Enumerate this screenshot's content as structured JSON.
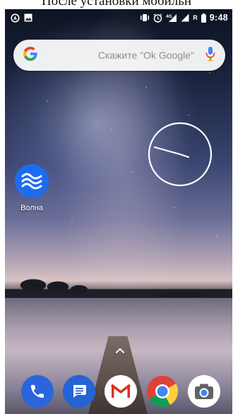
{
  "caption": {
    "text": "После установки мобильн"
  },
  "status_bar": {
    "left_icons": [
      "location-icon",
      "image-notification-icon"
    ],
    "right_icons": [
      "vibrate-icon",
      "alarm-icon",
      "signal-4g-icon",
      "signal-icon",
      "battery-icon"
    ],
    "network": "4G",
    "roaming": "R",
    "time": "9:48"
  },
  "search": {
    "hint": "Скажите \"Ok Google\""
  },
  "clock": {
    "hour_hand": "~9",
    "minute_hand": "~48"
  },
  "apps": [
    {
      "label": "Волна",
      "icon": "wave-icon"
    }
  ],
  "dock": [
    {
      "name": "phone",
      "icon": "phone-icon"
    },
    {
      "name": "messages",
      "icon": "messages-icon"
    },
    {
      "name": "gmail",
      "icon": "gmail-icon"
    },
    {
      "name": "chrome",
      "icon": "chrome-icon"
    },
    {
      "name": "camera",
      "icon": "camera-icon"
    }
  ],
  "colors": {
    "volna": "#1d6cf0",
    "phone": "#2a66d9",
    "gmail_red": "#d93025",
    "google_blue": "#4285f4"
  }
}
